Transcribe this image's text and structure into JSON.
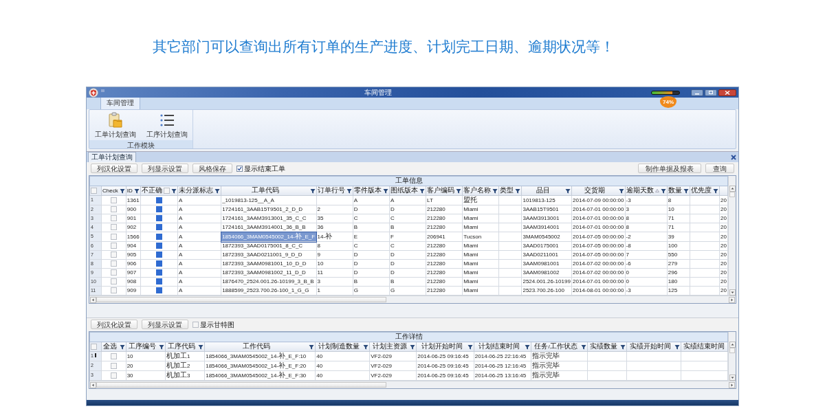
{
  "heading": "其它部门可以查询出所有订单的生产进度、计划完工日期、逾期状况等！",
  "window": {
    "title": "车间管理",
    "meter": {
      "level": 0.74
    },
    "badge": "74%"
  },
  "ribbon": {
    "tabs": [
      {
        "label": "车间管理",
        "selected": true
      }
    ],
    "groups": [
      {
        "label": "工作模块",
        "buttons": [
          {
            "label": "工单计划查询",
            "kind": "clipboard"
          },
          {
            "label": "工序计划查询",
            "kind": "list"
          }
        ]
      }
    ]
  },
  "document_tabs": [
    {
      "label": "工单计划查询",
      "selected": true
    }
  ],
  "order_panel": {
    "toolbar": {
      "buttons": [
        "列汉化设置",
        "列显示设置",
        "风格保存"
      ],
      "checkbox": {
        "label": "显示结束工单",
        "checked": true
      },
      "right_buttons": [
        "制作单据及报表",
        "查询"
      ]
    },
    "grid": {
      "group_header": "工单信息",
      "select_all": false,
      "columns": [
        {
          "label": "Check",
          "kind": "checkbox",
          "filter": true
        },
        {
          "label": "ID",
          "kind": "text",
          "filter": true
        },
        {
          "label": "不正确",
          "kind": "checkbox",
          "header_checked": false,
          "filter": true
        },
        {
          "label": "未分派标志",
          "kind": "text",
          "filter": true
        },
        {
          "label": "工单代码",
          "kind": "key",
          "filter": true
        },
        {
          "label": "订单行号",
          "kind": "text",
          "filter": true
        },
        {
          "label": "零件版本",
          "kind": "text",
          "filter": true
        },
        {
          "label": "图纸版本",
          "kind": "text",
          "filter": true
        },
        {
          "label": "客户编码",
          "kind": "text",
          "filter": true
        },
        {
          "label": "客户名称",
          "kind": "text",
          "filter": true
        },
        {
          "label": "类型",
          "kind": "text",
          "filter": true
        },
        {
          "label": "品目",
          "kind": "text",
          "filter": true
        },
        {
          "label": "交货期",
          "kind": "text",
          "filter": true
        },
        {
          "label": "逾期天数",
          "kind": "text",
          "filter": true,
          "sorted": true
        },
        {
          "label": "数量",
          "kind": "text",
          "filter": true
        },
        {
          "label": "优先度",
          "kind": "text",
          "filter": true
        },
        {
          "kind": "text",
          "filter": false
        }
      ],
      "rows": [
        {
          "number": "1",
          "selected": false,
          "cells": [
            false,
            "1361",
            true,
            "A",
            "_1019813-125__A_A",
            null,
            "A",
            "A",
            "LT",
            "盟托",
            null,
            "1019813-125",
            "2014-07-09 00:00:00",
            "-3",
            "8",
            null,
            "20"
          ]
        },
        {
          "number": "2",
          "selected": false,
          "cells": [
            false,
            "900",
            true,
            "A",
            "1724161_3AAB15T9501_2_D_D",
            "2",
            "D",
            "D",
            "212280",
            "Miami",
            null,
            "3AAB15T9501",
            "2014-07-01 00:00:00",
            "3",
            "10",
            null,
            "20"
          ]
        },
        {
          "number": "3",
          "selected": false,
          "cells": [
            false,
            "901",
            true,
            "A",
            "1724161_3AAM3913001_35_C_C",
            "35",
            "C",
            "C",
            "212280",
            "Miami",
            null,
            "3AAM3913001",
            "2014-07-01 00:00:00",
            "8",
            "71",
            null,
            "20"
          ]
        },
        {
          "number": "4",
          "selected": false,
          "cells": [
            false,
            "902",
            true,
            "A",
            "1724161_3AAM3914001_36_B_B",
            "36",
            "B",
            "B",
            "212280",
            "Miami",
            null,
            "3AAM3914001",
            "2014-07-01 00:00:00",
            "8",
            "71",
            null,
            "20"
          ]
        },
        {
          "number": "5",
          "selected": true,
          "cells": [
            false,
            "1566",
            true,
            "A",
            "1854066_3MAM0545002_14-补_E_F",
            "14-补",
            "E",
            "F",
            "206941",
            "Tucson",
            null,
            "3MAM0545002",
            "2014-07-05 00:00:00",
            "-2",
            "39",
            null,
            "20"
          ]
        },
        {
          "number": "6",
          "selected": false,
          "cells": [
            false,
            "904",
            true,
            "A",
            "1872393_3AAD0175001_8_C_C",
            "8",
            "C",
            "C",
            "212280",
            "Miami",
            null,
            "3AAD0175001",
            "2014-07-05 00:00:00",
            "-8",
            "100",
            null,
            "20"
          ]
        },
        {
          "number": "7",
          "selected": false,
          "cells": [
            false,
            "905",
            true,
            "A",
            "1872393_3AAD0211001_9_D_D",
            "9",
            "D",
            "D",
            "212280",
            "Miami",
            null,
            "3AAD0211001",
            "2014-07-05 00:00:00",
            "7",
            "550",
            null,
            "20"
          ]
        },
        {
          "number": "8",
          "selected": false,
          "cells": [
            false,
            "906",
            true,
            "A",
            "1872393_3AAM0981001_10_D_D",
            "10",
            "D",
            "D",
            "212280",
            "Miami",
            null,
            "3AAM0981001",
            "2014-07-02 00:00:00",
            "-6",
            "279",
            null,
            "20"
          ]
        },
        {
          "number": "9",
          "selected": false,
          "cells": [
            false,
            "907",
            true,
            "A",
            "1872393_3AAM0981002_11_D_D",
            "11",
            "D",
            "D",
            "212280",
            "Miami",
            null,
            "3AAM0981002",
            "2014-07-02 00:00:00",
            "0",
            "296",
            null,
            "20"
          ]
        },
        {
          "number": "10",
          "selected": false,
          "cells": [
            false,
            "908",
            true,
            "A",
            "1876470_2524.001.26-10199_3_B_B",
            "3",
            "B",
            "B",
            "212280",
            "Miami",
            null,
            "2524.001.26-10199",
            "2014-07-01 00:00:00",
            "0",
            "180",
            null,
            "20"
          ]
        },
        {
          "number": "11",
          "selected": false,
          "cells": [
            false,
            "909",
            true,
            "A",
            "1888599_2523.700.26-100_1_G_G",
            "1",
            "G",
            "G",
            "212280",
            "Miami",
            null,
            "2523.700.26-100",
            "2014-08-01 00:00:00",
            "-3",
            "125",
            null,
            "20"
          ]
        }
      ]
    }
  },
  "detail_panel": {
    "toolbar": {
      "buttons": [
        "列汉化设置",
        "列显示设置"
      ],
      "checkbox": {
        "label": "显示甘特图",
        "checked": false
      }
    },
    "grid": {
      "group_header": "工作详情",
      "select_all": false,
      "columns": [
        {
          "label": "全选",
          "kind": "checkbox",
          "filter": true
        },
        {
          "label": "工序编号",
          "kind": "text",
          "filter": true
        },
        {
          "label": "工序代码",
          "kind": "text",
          "filter": true
        },
        {
          "label": "工作代码",
          "kind": "text",
          "filter": true
        },
        {
          "label": "计划制造数量",
          "kind": "text",
          "filter": true
        },
        {
          "label": "计划主资源",
          "kind": "text",
          "filter": true
        },
        {
          "label": "计划开始时间",
          "kind": "text",
          "filter": true
        },
        {
          "label": "计划结束时间",
          "kind": "text",
          "filter": true
        },
        {
          "label": "任务/工作状态",
          "kind": "text",
          "filter": true
        },
        {
          "label": "实绩数量",
          "kind": "text",
          "filter": true
        },
        {
          "label": "实绩开始时间",
          "kind": "text",
          "filter": true
        },
        {
          "label": "实绩结束时间",
          "kind": "text",
          "filter": false
        }
      ],
      "rows": [
        {
          "number": "1",
          "current": true,
          "cells": [
            false,
            "10",
            "机加工1",
            "1854066_3MAM0545002_14-补_E_F:10",
            "40",
            "VF2-029",
            "2014-06-25 09:16:45",
            "2014-06-25 22:16:45",
            "指示完毕",
            null,
            null,
            null
          ]
        },
        {
          "number": "2",
          "current": false,
          "cells": [
            false,
            "20",
            "机加工2",
            "1854066_3MAM0545002_14-补_E_F:20",
            "40",
            "VF2-029",
            "2014-06-25 09:16:45",
            "2014-06-25 12:16:45",
            "指示完毕",
            null,
            null,
            null
          ]
        },
        {
          "number": "3",
          "current": false,
          "cells": [
            false,
            "30",
            "机加工3",
            "1854066_3MAM0545002_14-补_E_F:30",
            "40",
            "VF2-029",
            "2014-06-25 09:16:45",
            "2014-06-25 13:16:45",
            "指示完毕",
            null,
            null,
            null
          ]
        }
      ]
    }
  }
}
